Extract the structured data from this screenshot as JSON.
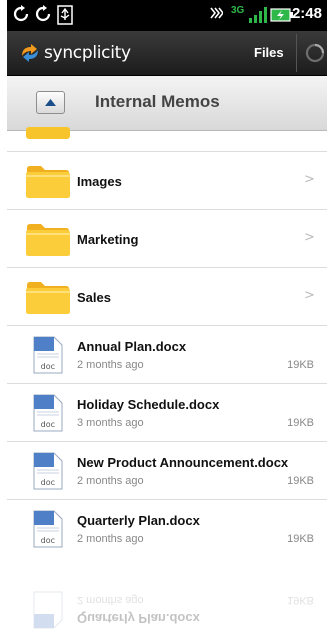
{
  "status_bar": {
    "time": "2:48",
    "network": "3G",
    "icons": [
      "sync-icon",
      "refresh-icon",
      "usb-icon",
      "vibrate-icon",
      "signal-icon",
      "battery-charging-icon"
    ]
  },
  "app_bar": {
    "logo": "syncplicity",
    "files_label": "Files",
    "icon": "sync-spinner-icon"
  },
  "header": {
    "title": "Internal Memos",
    "up_icon": "up-arrow-icon"
  },
  "folders": [
    {
      "name": "Images"
    },
    {
      "name": "Marketing"
    },
    {
      "name": "Sales"
    }
  ],
  "files": [
    {
      "name": "Annual Plan.docx",
      "modified": "2 months ago",
      "size": "19KB",
      "icon_label": "doc"
    },
    {
      "name": "Holiday Schedule.docx",
      "modified": "3 months ago",
      "size": "19KB",
      "icon_label": "doc"
    },
    {
      "name": "New Product Announcement.docx",
      "modified": "2 months ago",
      "size": "19KB",
      "icon_label": "doc"
    },
    {
      "name": "Quarterly Plan.docx",
      "modified": "2 months ago",
      "size": "19KB",
      "icon_label": "doc"
    }
  ],
  "colors": {
    "folder": "#f7c42c",
    "logo_orange": "#f29a1f",
    "logo_blue": "#3a8fd8"
  }
}
